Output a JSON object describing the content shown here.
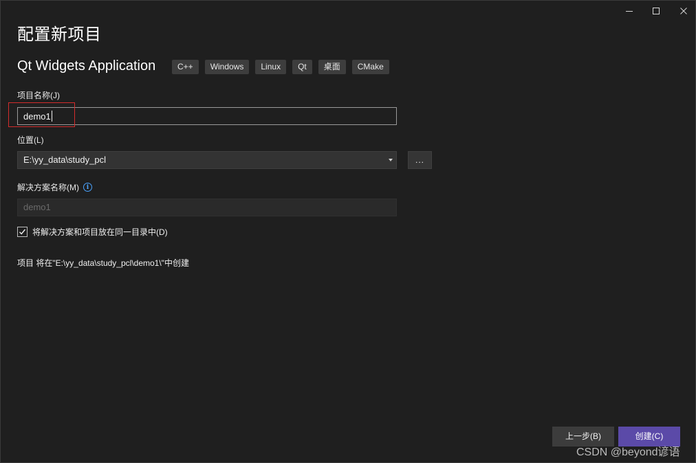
{
  "window": {
    "controls": {
      "minimize_icon": "minimize-icon",
      "maximize_icon": "maximize-icon",
      "close_icon": "close-icon"
    }
  },
  "dialog": {
    "title": "配置新项目",
    "template_name": "Qt Widgets Application",
    "tags": [
      "C++",
      "Windows",
      "Linux",
      "Qt",
      "桌面",
      "CMake"
    ]
  },
  "form": {
    "project_name": {
      "label": "项目名称(J)",
      "value": "demo1"
    },
    "location": {
      "label": "位置(L)",
      "value": "E:\\yy_data\\study_pcl",
      "browse_label": "..."
    },
    "solution_name": {
      "label": "解决方案名称(M)",
      "value": "demo1",
      "info_icon": "info-icon"
    },
    "same_directory": {
      "label": "将解决方案和项目放在同一目录中(D)",
      "checked": true
    },
    "creation_path_text": "项目 将在\"E:\\yy_data\\study_pcl\\demo1\\\"中创建"
  },
  "buttons": {
    "back_label": "上一步(B)",
    "create_label": "创建(C)"
  },
  "watermark": "CSDN @beyond谚语",
  "colors": {
    "background": "#1f1f1f",
    "primary_button": "#5b4aa8",
    "highlight_box": "#d42c2c",
    "info": "#4aa3ff"
  }
}
